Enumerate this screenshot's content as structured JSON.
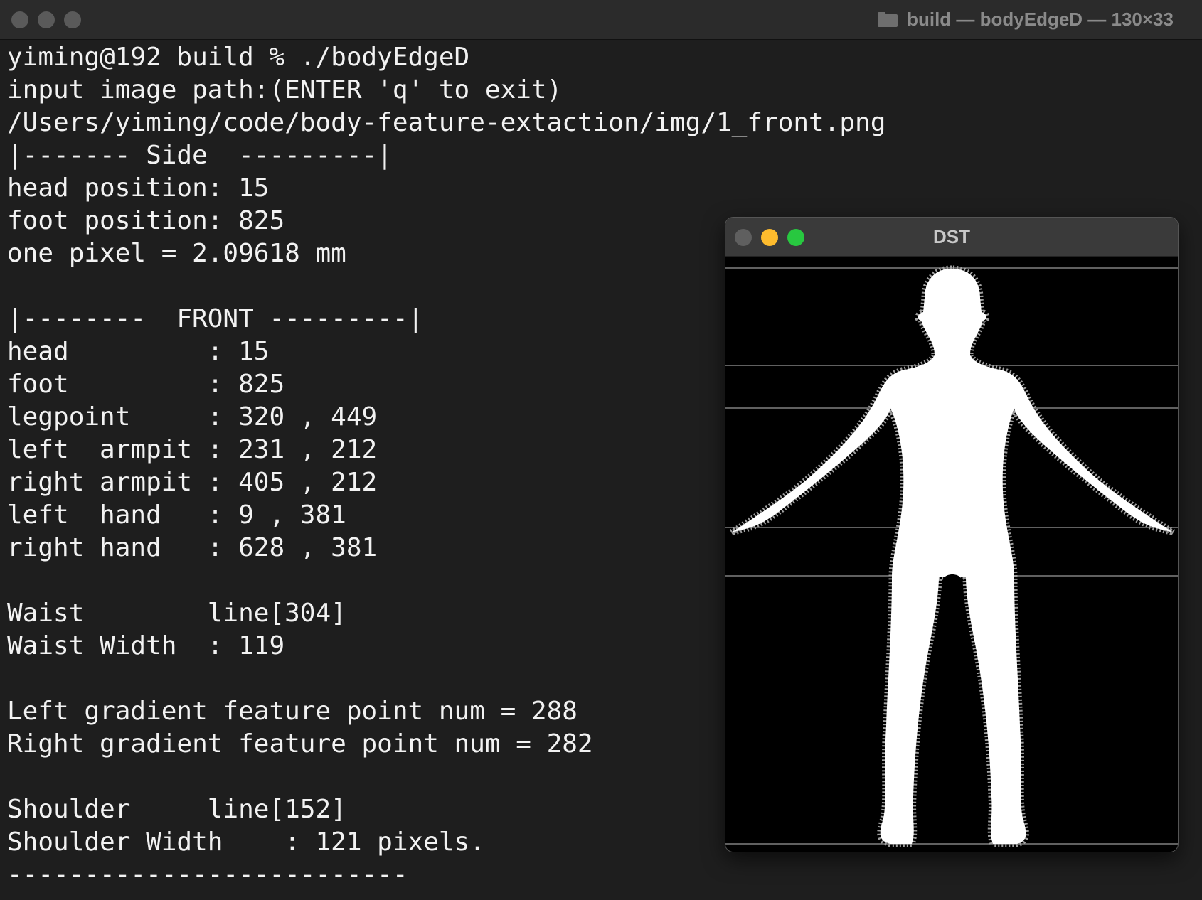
{
  "terminal": {
    "title": "build — bodyEdgeD — 130×33",
    "title_icon": "folder-icon",
    "lines": [
      "yiming@192 build % ./bodyEdgeD",
      "input image path:(ENTER 'q' to exit)",
      "/Users/yiming/code/body-feature-extaction/img/1_front.png",
      "|------- Side  ---------|",
      "head position: 15",
      "foot position: 825",
      "one pixel = 2.09618 mm",
      "",
      "|--------  FRONT ---------|",
      "head         : 15",
      "foot         : 825",
      "legpoint     : 320 , 449",
      "left  armpit : 231 , 212",
      "right armpit : 405 , 212",
      "left  hand   : 9 , 381",
      "right hand   : 628 , 381",
      "",
      "Waist        line[304]",
      "Waist Width  : 119",
      "",
      "Left gradient feature point num = 288",
      "Right gradient feature point num = 282",
      "",
      "Shoulder     line[152]",
      "Shoulder Width    : 121 pixels.",
      "--------------------------"
    ]
  },
  "dst_window": {
    "title": "DST",
    "buttons": {
      "close_color": "#5f5f5f",
      "minimize_color": "#febc2e",
      "maximize_color": "#28c840"
    },
    "image": "body-silhouette"
  },
  "colors": {
    "terminal_background": "#1e1e1e",
    "terminal_text": "#f2f2f2",
    "title_text": "#8a8a8a",
    "silhouette": "#ffffff",
    "edge_marks": "#a0a0a0",
    "guide_lines": "#9a9a9a"
  }
}
